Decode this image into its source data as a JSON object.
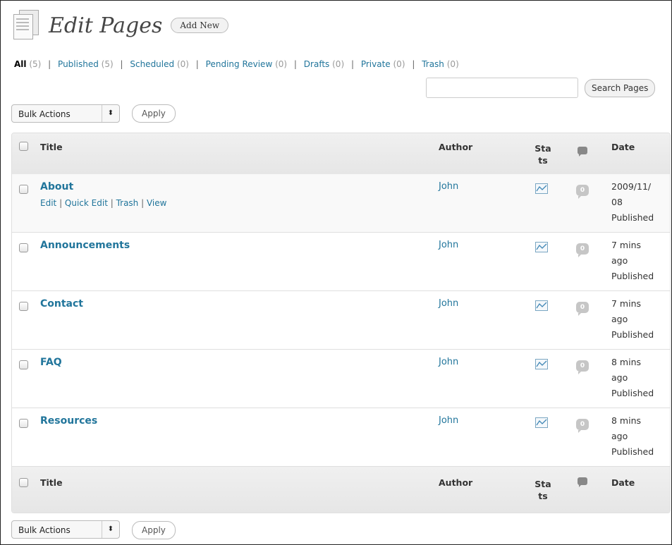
{
  "header": {
    "title": "Edit Pages",
    "add_new": "Add New"
  },
  "filters": [
    {
      "label": "All",
      "count": "(5)"
    },
    {
      "label": "Published",
      "count": "(5)"
    },
    {
      "label": "Scheduled",
      "count": "(0)"
    },
    {
      "label": "Pending Review",
      "count": "(0)"
    },
    {
      "label": "Drafts",
      "count": "(0)"
    },
    {
      "label": "Private",
      "count": "(0)"
    },
    {
      "label": "Trash",
      "count": "(0)"
    }
  ],
  "filter_separator": "|",
  "search": {
    "placeholder": "",
    "button": "Search Pages"
  },
  "bulk": {
    "label": "Bulk Actions",
    "arrows": "⬍",
    "apply": "Apply"
  },
  "table": {
    "headers": {
      "title": "Title",
      "author": "Author",
      "stats_line1": "Sta",
      "stats_line2": "ts",
      "date": "Date"
    },
    "rows": [
      {
        "title": "About",
        "author": "John",
        "comments": "0",
        "date_line1": "2009/11/",
        "date_line2": "08",
        "status": "Published",
        "actions": {
          "edit": "Edit",
          "quick_edit": "Quick Edit",
          "trash": "Trash",
          "view": "View"
        }
      },
      {
        "title": "Announcements",
        "author": "John",
        "comments": "0",
        "date_line1": "7 mins",
        "date_line2": "ago",
        "status": "Published"
      },
      {
        "title": "Contact",
        "author": "John",
        "comments": "0",
        "date_line1": "7 mins",
        "date_line2": "ago",
        "status": "Published"
      },
      {
        "title": "FAQ",
        "author": "John",
        "comments": "0",
        "date_line1": "8 mins",
        "date_line2": "ago",
        "status": "Published"
      },
      {
        "title": "Resources",
        "author": "John",
        "comments": "0",
        "date_line1": "8 mins",
        "date_line2": "ago",
        "status": "Published"
      }
    ]
  },
  "colors": {
    "link": "#21759b",
    "header_bg": "#e9e9e9",
    "bubble": "#c6c6c6"
  },
  "icons": {
    "page": "pages-icon",
    "stats": "stats-chart-icon",
    "comments": "comment-bubble-icon"
  }
}
